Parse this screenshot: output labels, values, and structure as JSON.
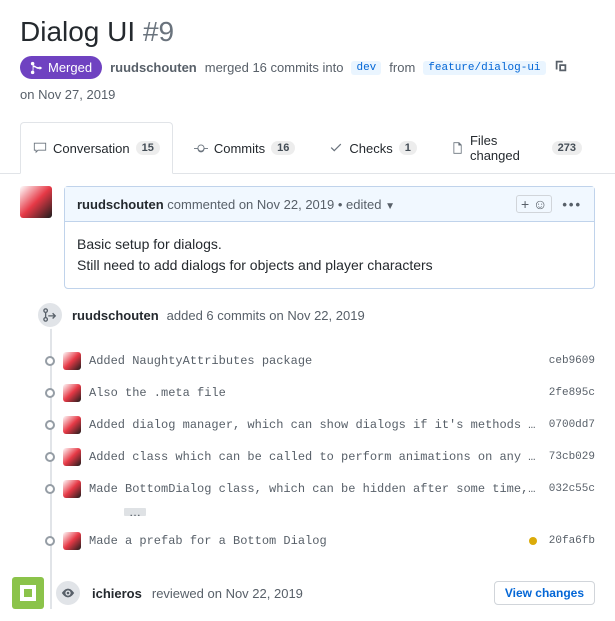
{
  "title": "Dialog UI",
  "issue_number": "#9",
  "merged_label": "Merged",
  "merge_line": {
    "author": "ruudschouten",
    "verb": "merged 16 commits into",
    "base_branch": "dev",
    "from": "from",
    "head_branch": "feature/dialog-ui",
    "date": "on Nov 27, 2019"
  },
  "tabs": {
    "conversation": {
      "label": "Conversation",
      "count": "15"
    },
    "commits": {
      "label": "Commits",
      "count": "16"
    },
    "checks": {
      "label": "Checks",
      "count": "1"
    },
    "files": {
      "label": "Files changed",
      "count": "273"
    }
  },
  "comment": {
    "author": "ruudschouten",
    "meta": "commented on Nov 22, 2019 • edited",
    "body_line1": "Basic setup for dialogs.",
    "body_line2": "Still need to add dialogs for objects and player characters"
  },
  "added_commits": {
    "author": "ruudschouten",
    "text": "added 6 commits on Nov 22, 2019"
  },
  "commits": [
    {
      "msg": "Added NaughtyAttributes package",
      "hash": "ceb9609",
      "ellipsis": false,
      "status": ""
    },
    {
      "msg": "Also the .meta file",
      "hash": "2fe895c",
      "ellipsis": false,
      "status": ""
    },
    {
      "msg": "Added dialog manager, which can show dialogs if it's methods are called",
      "hash": "0700dd7",
      "ellipsis": false,
      "status": ""
    },
    {
      "msg": "Added class which can be called to perform animations on any UIElement",
      "hash": "73cb029",
      "ellipsis": false,
      "status": ""
    },
    {
      "msg": "Made BottomDialog class, which can be hidden after some time, also fa…",
      "hash": "032c55c",
      "ellipsis": true,
      "status": ""
    },
    {
      "msg": "Made a prefab for a Bottom Dialog",
      "hash": "20fa6fb",
      "ellipsis": false,
      "status": "pending"
    }
  ],
  "review": {
    "author": "ichieros",
    "text": "reviewed on Nov 22, 2019",
    "button": "View changes"
  }
}
